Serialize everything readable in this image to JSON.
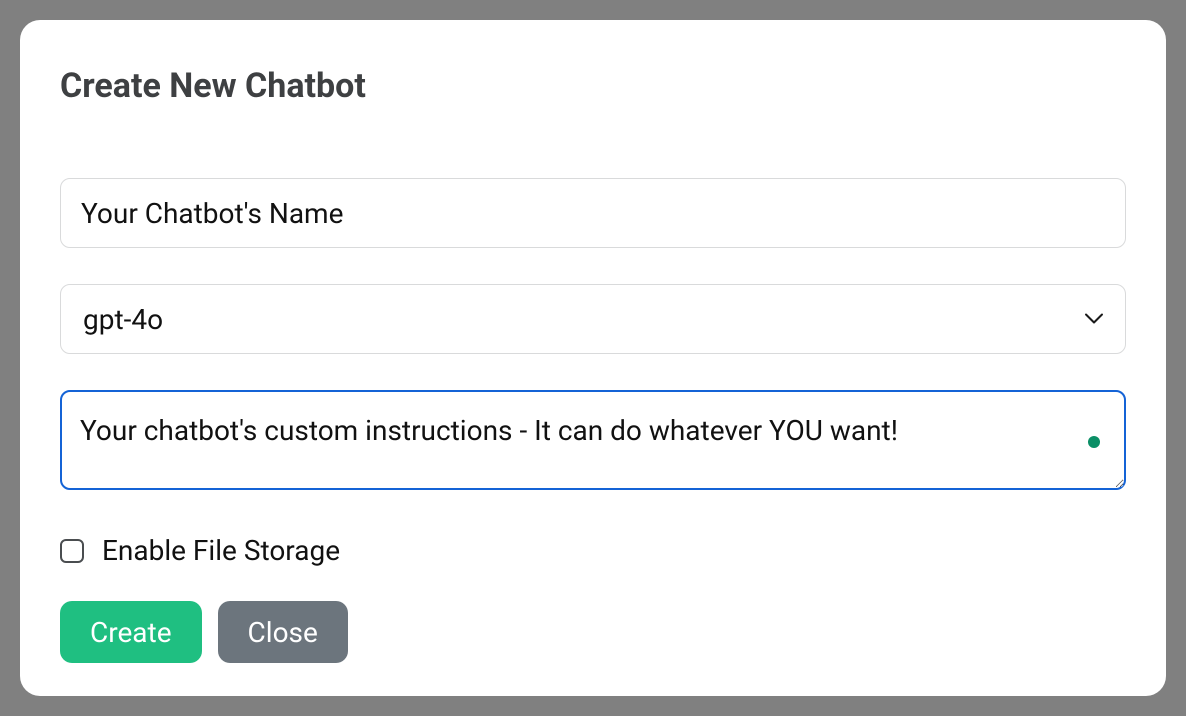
{
  "modal": {
    "title": "Create New Chatbot",
    "name_input": {
      "placeholder": "Your Chatbot's Name",
      "value": ""
    },
    "model_select": {
      "selected": "gpt-4o"
    },
    "instructions": {
      "placeholder": "Your chatbot's custom instructions - It can do whatever YOU want!",
      "value": ""
    },
    "file_storage": {
      "label": "Enable File Storage",
      "checked": false
    },
    "buttons": {
      "create": "Create",
      "close": "Close"
    },
    "colors": {
      "primary_button": "#1fbf81",
      "secondary_button": "#6c757d",
      "focus_border": "#1463d6",
      "status_dot": "#0b8f66"
    }
  }
}
